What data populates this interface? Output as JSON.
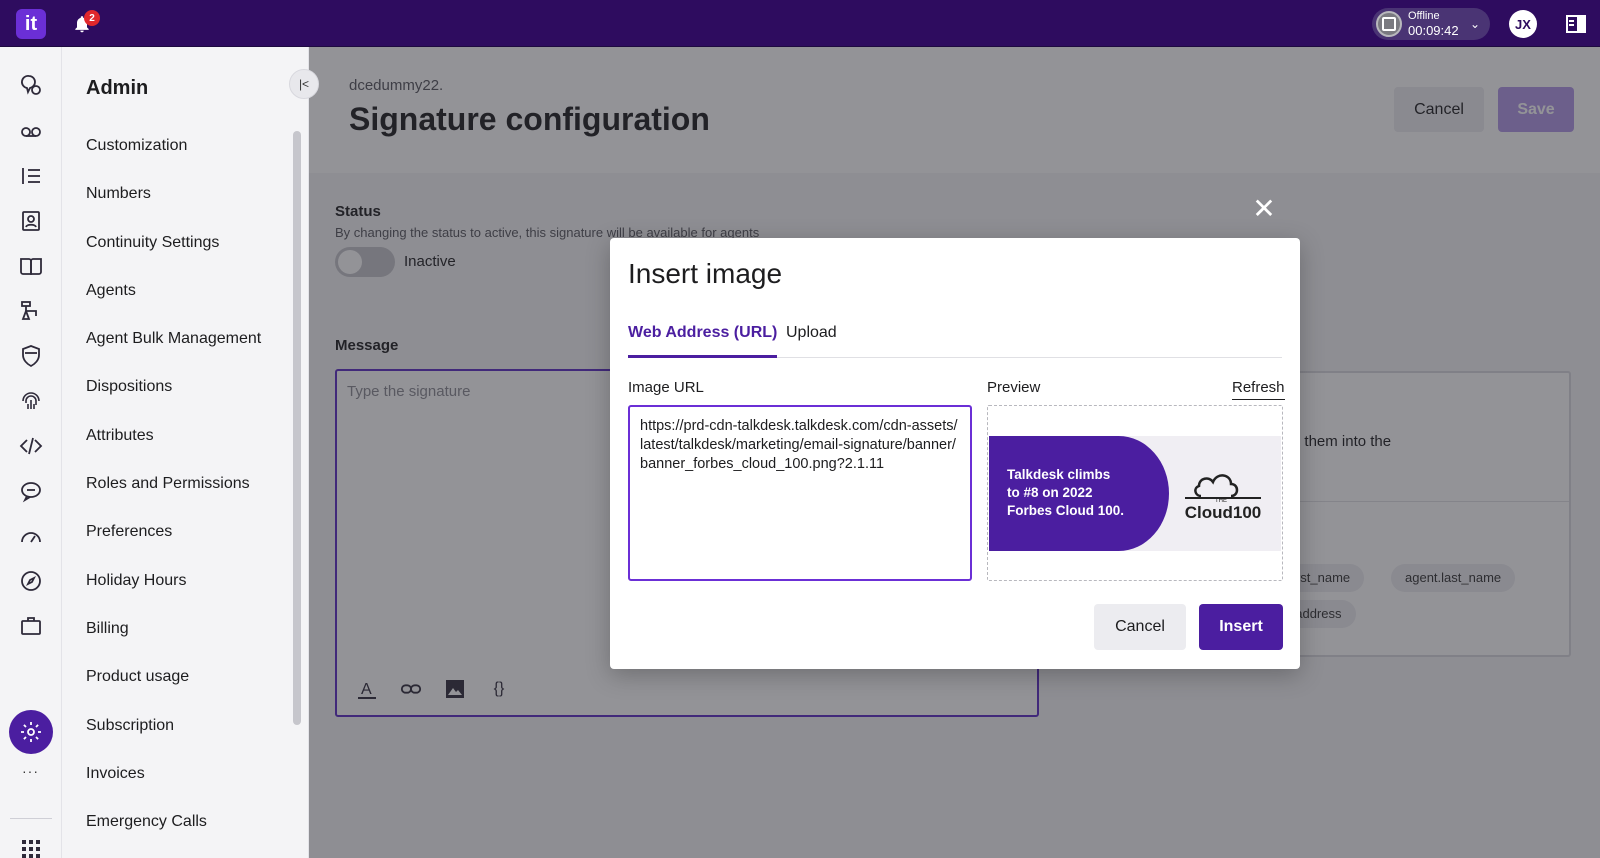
{
  "app": {
    "logo_text": "it",
    "notifications_count": "2",
    "status_label": "Offline",
    "status_timer": "00:09:42",
    "avatar_initials": "JX",
    "brand_color": "#2e0c5f",
    "accent_color": "#4b1ea0"
  },
  "rail": {
    "icons": [
      "conversations-icon",
      "voicemail-icon",
      "list-icon",
      "contacts-icon",
      "knowledge-icon",
      "flows-icon",
      "shield-icon",
      "fingerprint-icon",
      "code-icon",
      "chat-icon",
      "dashboard-icon",
      "explore-icon",
      "briefcase-icon",
      "settings-icon",
      "more-icon",
      "apps-grid-icon"
    ],
    "more_label": "···"
  },
  "admin": {
    "title": "Admin",
    "items": [
      {
        "label": "Customization"
      },
      {
        "label": "Numbers"
      },
      {
        "label": "Continuity Settings"
      },
      {
        "label": "Agents"
      },
      {
        "label": "Agent Bulk Management"
      },
      {
        "label": "Dispositions"
      },
      {
        "label": "Attributes"
      },
      {
        "label": "Roles and Permissions"
      },
      {
        "label": "Preferences"
      },
      {
        "label": "Holiday Hours"
      },
      {
        "label": "Billing"
      },
      {
        "label": "Product usage"
      },
      {
        "label": "Subscription"
      },
      {
        "label": "Invoices"
      },
      {
        "label": "Emergency Calls"
      }
    ]
  },
  "page": {
    "tenant": "dcedummy22.",
    "title": "Signature configuration",
    "cancel_label": "Cancel",
    "save_label": "Save"
  },
  "form": {
    "status_label": "Status",
    "status_help": "By changing the status to active, this signature will be available for agents",
    "toggle_state": "Inactive",
    "message_label": "Message",
    "message_placeholder": "Type the signature",
    "right_text": "nd dropping them into the",
    "chips": [
      "nt.first_name",
      "agent.last_name",
      "ail_address"
    ]
  },
  "modal": {
    "title": "Insert image",
    "tabs": [
      {
        "label": "Web Address (URL)",
        "active": true
      },
      {
        "label": "Upload",
        "active": false
      }
    ],
    "url_label": "Image URL",
    "url_value": "https://prd-cdn-talkdesk.talkdesk.com/cdn-assets/latest/talkdesk/marketing/email-signature/banner/banner_forbes_cloud_100.png?2.1.11",
    "preview_label": "Preview",
    "refresh_label": "Refresh",
    "banner_text_line1": "Talkdesk climbs",
    "banner_text_line2": "to #8 on 2022",
    "banner_text_line3": "Forbes Cloud 100.",
    "banner_logo_the": "THE",
    "banner_logo_text": "Cloud100",
    "cancel_label": "Cancel",
    "insert_label": "Insert"
  }
}
